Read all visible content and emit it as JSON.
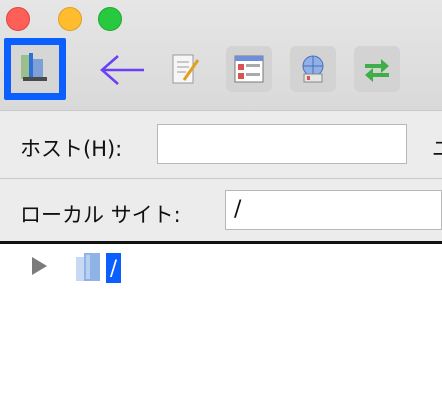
{
  "window": {
    "controls": [
      "close",
      "minimize",
      "zoom"
    ]
  },
  "toolbar": {
    "buttons": [
      {
        "icon": "site-manager-icon",
        "state": "selected"
      },
      {
        "icon": "edit-icon"
      },
      {
        "icon": "layout-icon"
      },
      {
        "icon": "network-icon"
      },
      {
        "icon": "transfer-icon"
      }
    ],
    "annotation_arrow_color": "#6a3ff5"
  },
  "connect": {
    "host_label": "ホスト(H):",
    "host_value": "",
    "next_label_fragment": "ユ"
  },
  "local": {
    "site_label": "ローカル サイト:",
    "site_value": "/"
  },
  "tree": {
    "items": [
      {
        "name": "/",
        "selected": true,
        "expanded": false
      }
    ]
  },
  "colors": {
    "accent": "#0b5fff"
  }
}
